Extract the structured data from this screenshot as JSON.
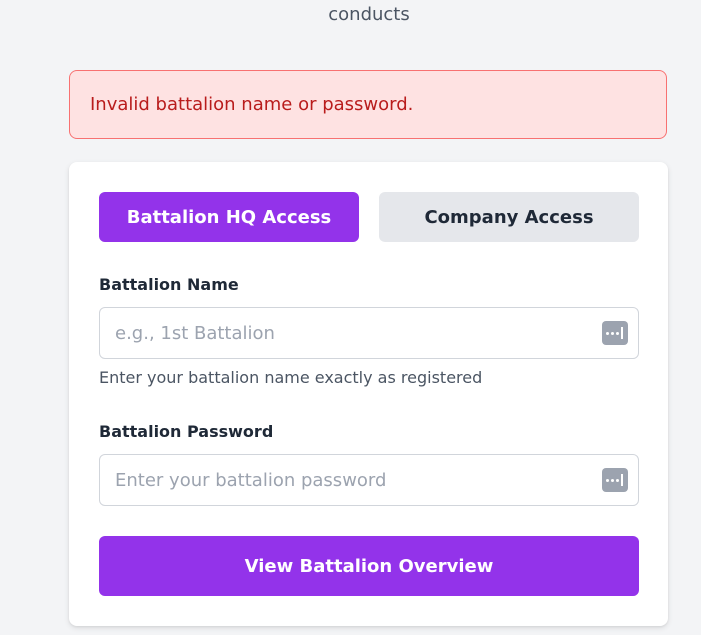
{
  "header": {
    "partial_text": "conducts"
  },
  "error": {
    "message": "Invalid battalion name or password."
  },
  "tabs": [
    {
      "label": "Battalion HQ Access",
      "active": true
    },
    {
      "label": "Company Access",
      "active": false
    }
  ],
  "form": {
    "battalion_name": {
      "label": "Battalion Name",
      "placeholder": "e.g., 1st Battalion",
      "value": "",
      "helper": "Enter your battalion name exactly as registered",
      "icon": "password-manager-icon"
    },
    "battalion_password": {
      "label": "Battalion Password",
      "placeholder": "Enter your battalion password",
      "value": "",
      "icon": "password-manager-icon"
    },
    "submit_label": "View Battalion Overview"
  },
  "colors": {
    "accent": "#9333ea",
    "error_bg": "#fee2e2",
    "error_border": "#f87171",
    "error_text": "#b91c1c",
    "tab_inactive_bg": "#e5e7eb"
  }
}
